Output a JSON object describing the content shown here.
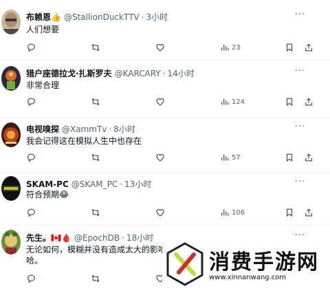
{
  "tweets": [
    {
      "name": "布赖恩👍",
      "handle": "@StallionDuckTTV",
      "sep": "·",
      "time": "3小时",
      "text": "人们想要",
      "views": "23"
    },
    {
      "name": "猎户座德拉戈·扎斯罗夫",
      "handle": "@KARCARY",
      "sep": "·",
      "time": "14小时",
      "text": "非常合理",
      "views": "124"
    },
    {
      "name": "电视嗅探",
      "handle": "@XammTv",
      "sep": "·",
      "time": "8小时",
      "text": "我会记得这在模拟人生中也存在",
      "views": "57"
    },
    {
      "name": "SKAM-PC",
      "handle": "@SKAM_PC",
      "sep": "·",
      "time": "13小时",
      "text": "符合预期😂",
      "views": "106"
    },
    {
      "name": "先生。🇨🇦🩸",
      "handle": "@EpochDB",
      "sep": "·",
      "time": "18小时",
      "text": "无论如何，模糊并没有造成太大的影响",
      "text2": "哈。",
      "views": ""
    }
  ],
  "more_label": "···",
  "watermark": {
    "title": "消费手游网",
    "url": "www.xinnanwang.com"
  },
  "icons": [
    "reply-icon",
    "retweet-icon",
    "like-icon",
    "views-icon",
    "bookmark-icon",
    "share-icon",
    "more-icon"
  ]
}
